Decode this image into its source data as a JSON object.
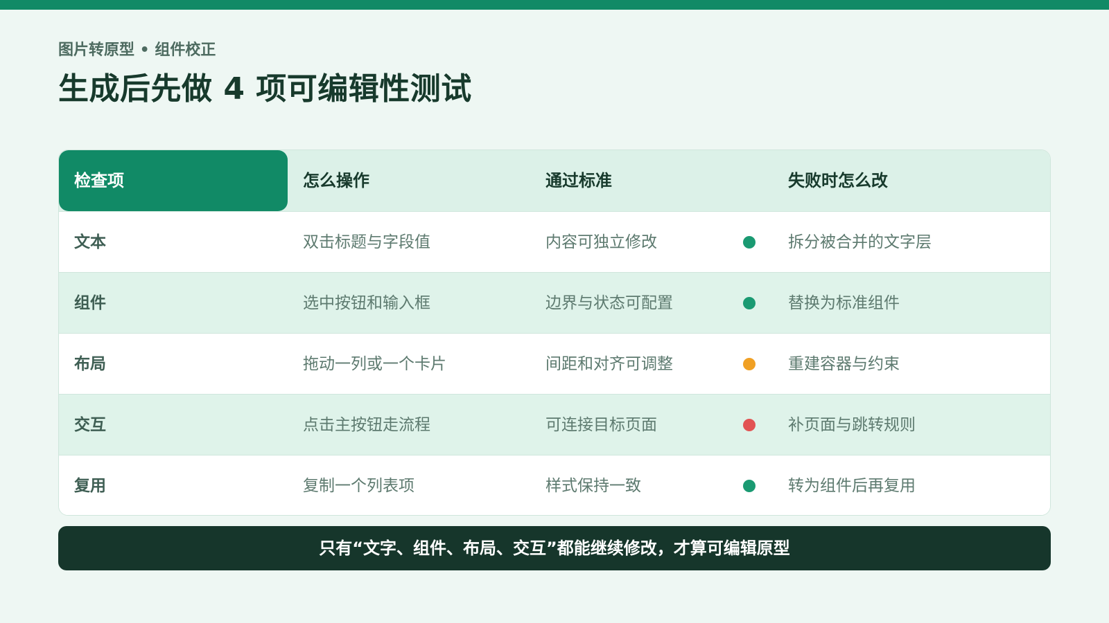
{
  "colors": {
    "accent": "#118a66",
    "green": "#1a9a72",
    "orange": "#f0a024",
    "red": "#e25353",
    "dark": "#16362b"
  },
  "header": {
    "eyebrow": "图片转原型 • 组件校正",
    "title": "生成后先做 4 项可编辑性测试"
  },
  "table": {
    "columns": [
      "检查项",
      "怎么操作",
      "通过标准",
      "失败时怎么改"
    ],
    "rows": [
      {
        "item": "文本",
        "action": "双击标题与字段值",
        "standard": "内容可独立修改",
        "status": "green",
        "fix": "拆分被合并的文字层"
      },
      {
        "item": "组件",
        "action": "选中按钮和输入框",
        "standard": "边界与状态可配置",
        "status": "green",
        "fix": "替换为标准组件"
      },
      {
        "item": "布局",
        "action": "拖动一列或一个卡片",
        "standard": "间距和对齐可调整",
        "status": "orange",
        "fix": "重建容器与约束"
      },
      {
        "item": "交互",
        "action": "点击主按钮走流程",
        "standard": "可连接目标页面",
        "status": "red",
        "fix": "补页面与跳转规则"
      },
      {
        "item": "复用",
        "action": "复制一个列表项",
        "standard": "样式保持一致",
        "status": "green",
        "fix": "转为组件后再复用"
      }
    ]
  },
  "footer": {
    "text": "只有“文字、组件、布局、交互”都能继续修改，才算可编辑原型"
  }
}
